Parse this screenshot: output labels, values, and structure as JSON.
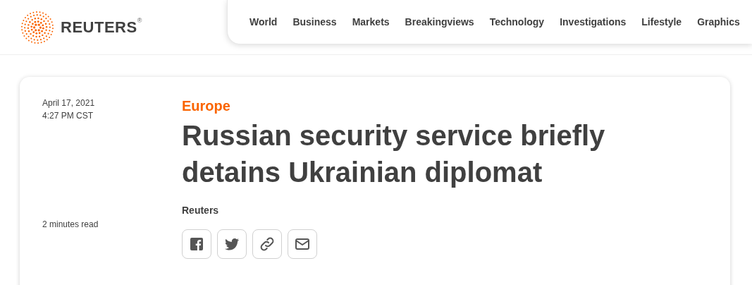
{
  "header": {
    "logo": {
      "wordmark": "REUTERS",
      "mark": "®"
    },
    "nav": [
      "World",
      "Business",
      "Markets",
      "Breakingviews",
      "Technology",
      "Investigations",
      "Lifestyle",
      "Graphics"
    ]
  },
  "article": {
    "date": "April 17, 2021",
    "time": "4:27 PM CST",
    "read_time": "2 minutes read",
    "section": "Europe",
    "headline": "Russian security service briefly detains Ukrainian diplomat",
    "author": "Reuters",
    "share": [
      {
        "kind": "facebook"
      },
      {
        "kind": "twitter"
      },
      {
        "kind": "link"
      },
      {
        "kind": "email"
      }
    ]
  }
}
